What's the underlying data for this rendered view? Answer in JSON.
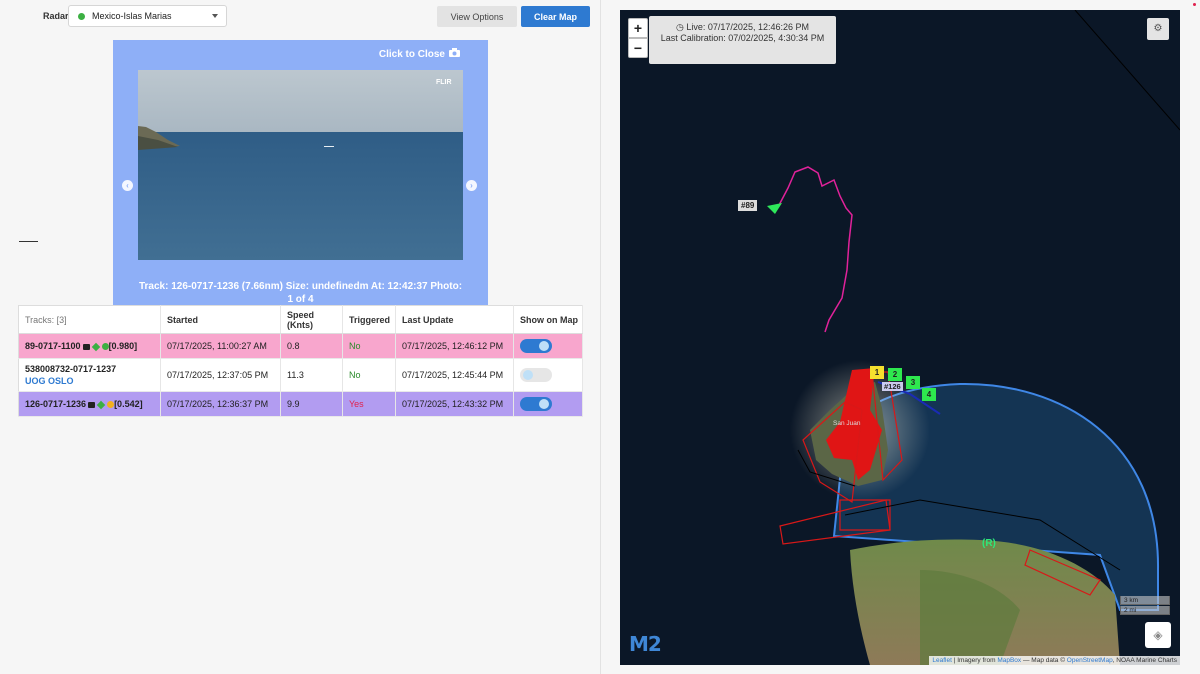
{
  "controls": {
    "radar_label": "Radar:",
    "radar_value": "Mexico-Islas Marias",
    "view_options": "View Options",
    "clear_map": "Clear Map"
  },
  "camera": {
    "close_text": "Click to Close",
    "watermark": "FLIR",
    "caption": "Track: 126-0717-1236 (7.66nm) Size: undefinedm At: 12:42:37 Photo: 1 of 4"
  },
  "table": {
    "headers": {
      "tracks": "Tracks: [3]",
      "started": "Started",
      "speed": "Speed (Knts)",
      "triggered": "Triggered",
      "last_update": "Last Update",
      "show_on_map": "Show on Map"
    },
    "rows": [
      {
        "id": "89-0717-1100",
        "sub": "",
        "score": "[0.980]",
        "dot_color": "#3cb043",
        "started": "07/17/2025, 11:00:27 AM",
        "speed": "0.8",
        "triggered": "No",
        "last_update": "07/17/2025, 12:46:12 PM",
        "show_on_map": true,
        "row_color": "pink"
      },
      {
        "id": "538008732-0717-1237",
        "sub": "UOG OSLO",
        "score": "",
        "dot_color": "",
        "started": "07/17/2025, 12:37:05 PM",
        "speed": "11.3",
        "triggered": "No",
        "last_update": "07/17/2025, 12:45:44 PM",
        "show_on_map": false,
        "row_color": "white"
      },
      {
        "id": "126-0717-1236",
        "sub": "",
        "score": "[0.542]",
        "dot_color": "#f2b01e",
        "started": "07/17/2025, 12:36:37 PM",
        "speed": "9.9",
        "triggered": "Yes",
        "last_update": "07/17/2025, 12:43:32 PM",
        "show_on_map": true,
        "row_color": "purple"
      }
    ]
  },
  "map": {
    "live": "Live: 07/17/2025, 12:46:26 PM",
    "calibration": "Last Calibration: 07/02/2025, 4:30:34 PM",
    "zoom_in": "+",
    "zoom_out": "−",
    "track_label_89": "#89",
    "track_label_126": "#126",
    "markers": [
      "1",
      "2",
      "3",
      "4"
    ],
    "place": "San Juan",
    "radar_symbol": "(R)",
    "scale_km": "3 km",
    "scale_mi": "2 mi",
    "brand": "M2",
    "attribution_leaflet": "Leaflet",
    "attribution_text1": " | Imagery from ",
    "attribution_mapbox": "MapBox",
    "attribution_text2": " — Map data © ",
    "attribution_osm": "OpenStreetMap",
    "attribution_text3": ", NOAA Marine Charts"
  }
}
